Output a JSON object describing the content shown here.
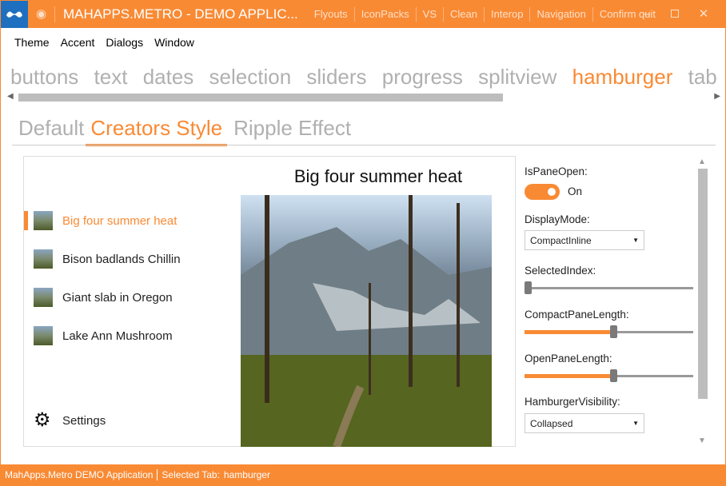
{
  "window": {
    "title": "MAHAPPS.METRO - DEMO APPLIC...",
    "commands": [
      "Flyouts",
      "IconPacks",
      "VS",
      "Clean",
      "Interop",
      "Navigation",
      "Confirm quit"
    ],
    "accent": "#f98a34"
  },
  "menu": [
    "Theme",
    "Accent",
    "Dialogs",
    "Window"
  ],
  "main_tabs": [
    "buttons",
    "text",
    "dates",
    "selection",
    "sliders",
    "progress",
    "splitview",
    "hamburger",
    "tabcontrol"
  ],
  "selected_main_tab": "hamburger",
  "sub_tabs": [
    "Default",
    "Creators Style",
    "Ripple Effect"
  ],
  "selected_sub_tab": "Creators Style",
  "hamburger": {
    "items": [
      {
        "label": "Big four summer heat",
        "selected": true
      },
      {
        "label": "Bison badlands Chillin"
      },
      {
        "label": "Giant slab in Oregon"
      },
      {
        "label": "Lake Ann Mushroom"
      }
    ],
    "settings_label": "Settings",
    "content_title": "Big four summer heat"
  },
  "options": {
    "is_pane_open_label": "IsPaneOpen:",
    "is_pane_open_state": "On",
    "display_mode_label": "DisplayMode:",
    "display_mode_value": "CompactInline",
    "selected_index_label": "SelectedIndex:",
    "selected_index_fraction": 0,
    "compact_pane_length_label": "CompactPaneLength:",
    "compact_pane_length_fraction": 0.53,
    "open_pane_length_label": "OpenPaneLength:",
    "open_pane_length_fraction": 0.53,
    "hamburger_visibility_label": "HamburgerVisibility:",
    "hamburger_visibility_value": "Collapsed"
  },
  "status": {
    "app": "MahApps.Metro DEMO Application",
    "selected_tab_label": "Selected Tab:",
    "selected_tab_value": "hamburger"
  }
}
